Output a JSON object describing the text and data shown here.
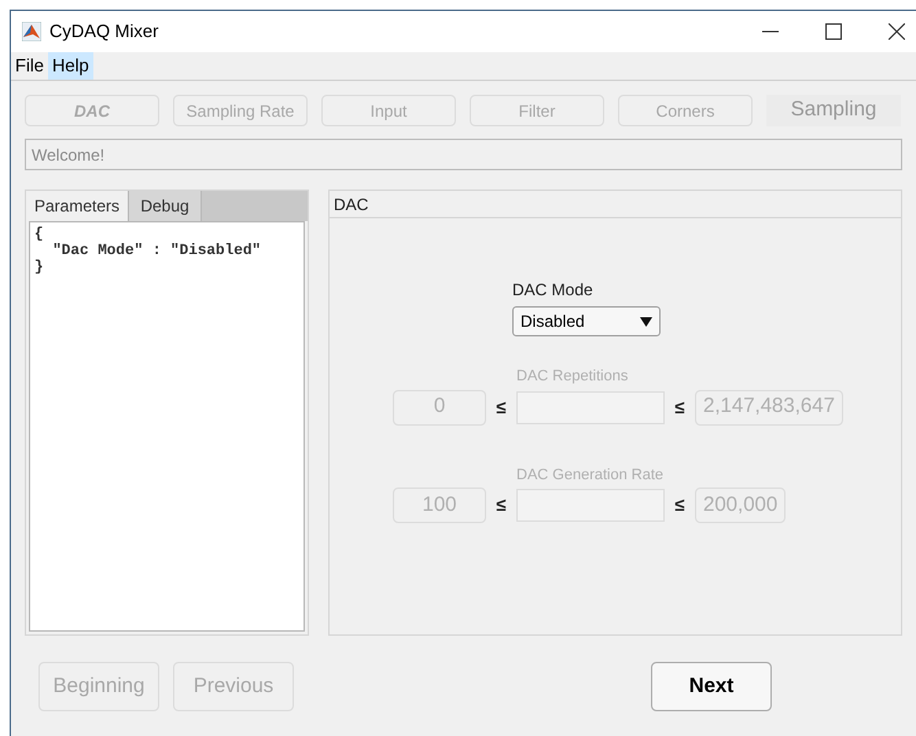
{
  "window": {
    "title": "CyDAQ Mixer"
  },
  "menu": [
    {
      "label": "File",
      "selected": false
    },
    {
      "label": "Help",
      "selected": true
    }
  ],
  "steps": [
    {
      "kind": "button",
      "label": "DAC",
      "current": true
    },
    {
      "kind": "button",
      "label": "Sampling Rate",
      "current": false
    },
    {
      "kind": "button",
      "label": "Input",
      "current": false
    },
    {
      "kind": "button",
      "label": "Filter",
      "current": false
    },
    {
      "kind": "button",
      "label": "Corners",
      "current": false
    },
    {
      "kind": "label",
      "label": "Sampling",
      "current": false
    }
  ],
  "status": {
    "value": "Welcome!"
  },
  "tabs": [
    {
      "label": "Parameters",
      "selected": true
    },
    {
      "label": "Debug",
      "selected": false
    }
  ],
  "parameters_text": [
    "{",
    "  \"Dac Mode\" : \"Disabled\"",
    "}"
  ],
  "dac_panel": {
    "title": "DAC",
    "mode_label": "DAC Mode",
    "mode_value": "Disabled",
    "ranges": [
      {
        "label": "DAC Repetitions",
        "min": "0",
        "symbol_min": "≤",
        "symbol_max": "≤",
        "max": "2,147,483,647",
        "disabled": true
      },
      {
        "label": "DAC Generation Rate",
        "min": "100",
        "symbol_min": "≤",
        "symbol_max": "≤",
        "max": "200,000",
        "disabled": true
      }
    ]
  },
  "nav_buttons": [
    {
      "label": "Beginning",
      "disabled": true
    },
    {
      "label": "Previous",
      "disabled": true
    },
    {
      "label": "Next",
      "disabled": false
    }
  ]
}
